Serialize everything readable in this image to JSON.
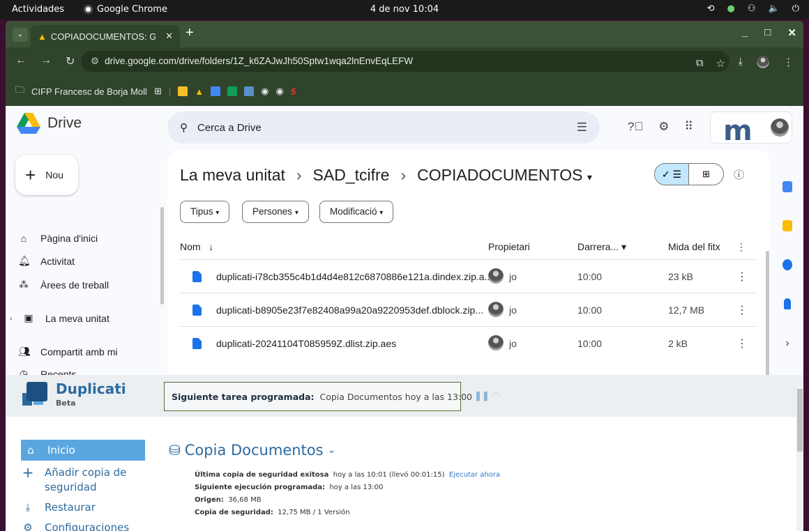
{
  "os": {
    "activities": "Actividades",
    "app": "Google Chrome",
    "clock": "4 de nov 10:04"
  },
  "chrome": {
    "tab_title": "COPIADOCUMENTOS: G",
    "url": "drive.google.com/drive/folders/1Z_k6ZAJwJh50Sptw1wqa2lnEnvEqLEFW",
    "bookmark_folder": "CIFP Francesc de Borja Moll",
    "bookmark_five": "5"
  },
  "drive": {
    "brand": "Drive",
    "search_placeholder": "Cerca a Drive",
    "new_label": "Nou",
    "sidebar": [
      "Pàgina d'inici",
      "Activitat",
      "Àrees de treball",
      "La meva unitat",
      "Compartit amb mi",
      "Recents"
    ],
    "breadcrumb": [
      "La meva unitat",
      "SAD_tcifre",
      "COPIADOCUMENTOS"
    ],
    "filters": [
      "Tipus",
      "Persones",
      "Modificació"
    ],
    "columns": {
      "name": "Nom",
      "owner": "Propietari",
      "modified": "Darrera...",
      "size": "Mida del fitx"
    },
    "files": [
      {
        "name": "duplicati-i78cb355c4b1d4d4e812c6870886e121a.dindex.zip.a...",
        "owner": "jo",
        "time": "10:00",
        "size": "23 kB"
      },
      {
        "name": "duplicati-b8905e23f7e82408a99a20a9220953def.dblock.zip...",
        "owner": "jo",
        "time": "10:00",
        "size": "12,7 MB"
      },
      {
        "name": "duplicati-20241104T085959Z.dlist.zip.aes",
        "owner": "jo",
        "time": "10:00",
        "size": "2 kB"
      }
    ]
  },
  "duplicati": {
    "title": "Duplicati",
    "beta": "Beta",
    "next_label": "Siguiente tarea programada:",
    "next_value": "Copia Documentos hoy a las 13:00",
    "nav": [
      "Inicio",
      "Añadir copia de",
      "seguridad",
      "Restaurar",
      "Configuraciones"
    ],
    "backup_name": "Copia Documentos",
    "info": {
      "last_label": "Última copia de seguridad exitosa",
      "last_value": "hoy a las 10:01 (llevó 00:01:15)",
      "run_now": "Ejecutar ahora",
      "next_label": "Siguiente ejecución programada:",
      "next_value": "hoy a las 13:00",
      "origin_label": "Origen:",
      "origin_value": "36,68 MB",
      "backup_label": "Copia de seguridad:",
      "backup_value": "12,75 MB / 1 Versión"
    }
  }
}
